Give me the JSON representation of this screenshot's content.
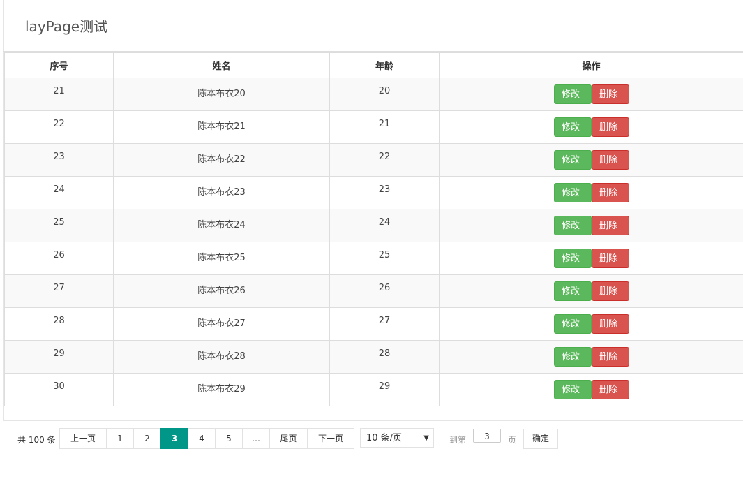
{
  "page": {
    "title": "layPage测试"
  },
  "table": {
    "headers": [
      "序号",
      "姓名",
      "年龄",
      "操作"
    ],
    "rows": [
      {
        "id": "21",
        "name": "陈本布衣20",
        "age": "20"
      },
      {
        "id": "22",
        "name": "陈本布衣21",
        "age": "21"
      },
      {
        "id": "23",
        "name": "陈本布衣22",
        "age": "22"
      },
      {
        "id": "24",
        "name": "陈本布衣23",
        "age": "23"
      },
      {
        "id": "25",
        "name": "陈本布衣24",
        "age": "24"
      },
      {
        "id": "26",
        "name": "陈本布衣25",
        "age": "25"
      },
      {
        "id": "27",
        "name": "陈本布衣26",
        "age": "26"
      },
      {
        "id": "28",
        "name": "陈本布衣27",
        "age": "27"
      },
      {
        "id": "29",
        "name": "陈本布衣28",
        "age": "28"
      },
      {
        "id": "30",
        "name": "陈本布衣29",
        "age": "29"
      }
    ],
    "edit_label": "修改",
    "delete_label": "删除"
  },
  "pager": {
    "count_text": "共 100 条",
    "prev_label": "上一页",
    "pages": [
      "1",
      "2",
      "3",
      "4",
      "5",
      "…"
    ],
    "active_page": "3",
    "last_label": "尾页",
    "next_label": "下一页",
    "per_page": "10 条/页",
    "goto_label": "到第",
    "goto_value": "3",
    "page_unit": "页",
    "confirm_label": "确定"
  },
  "colors": {
    "edit": "#5cb85c",
    "delete": "#d9534f",
    "active_page": "#009688"
  }
}
